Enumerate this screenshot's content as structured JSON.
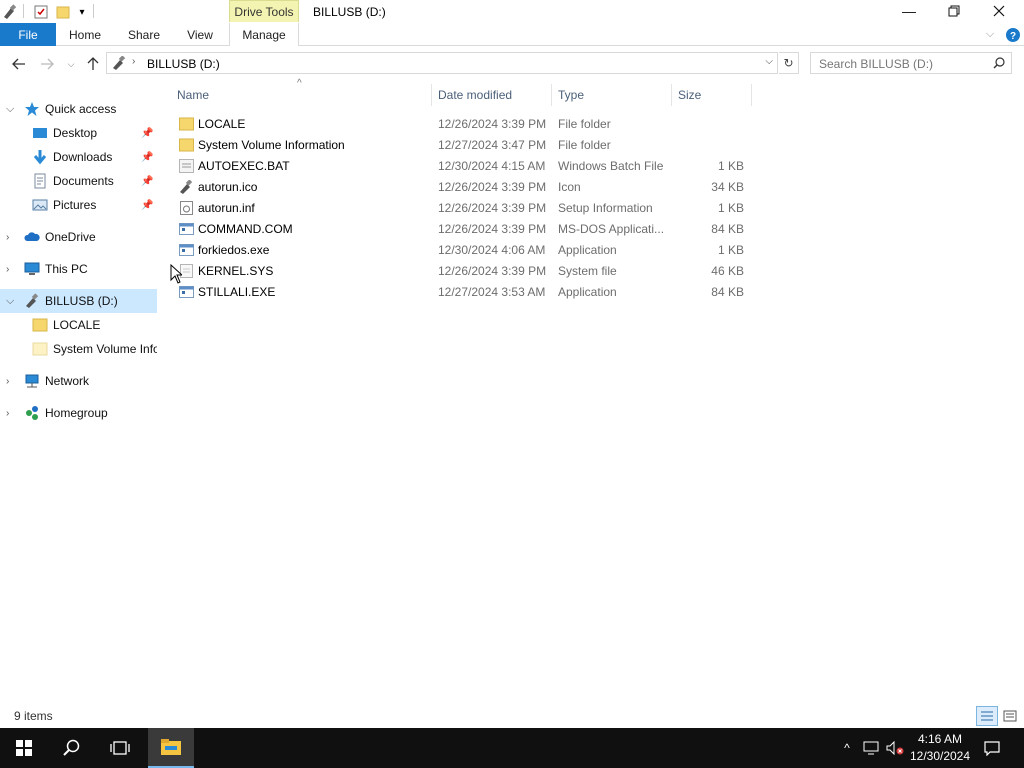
{
  "window": {
    "title": "BILLUSB (D:)",
    "drive_tools_label": "Drive Tools",
    "controls": [
      "minimize",
      "restore",
      "close"
    ]
  },
  "ribbon": {
    "tabs": [
      {
        "label": "File"
      },
      {
        "label": "Home"
      },
      {
        "label": "Share"
      },
      {
        "label": "View"
      },
      {
        "label": "Manage"
      }
    ]
  },
  "address": {
    "path": "BILLUSB (D:)",
    "search_placeholder": "Search BILLUSB (D:)"
  },
  "navpane": {
    "quick_access": "Quick access",
    "quick_items": [
      {
        "label": "Desktop"
      },
      {
        "label": "Downloads"
      },
      {
        "label": "Documents"
      },
      {
        "label": "Pictures"
      }
    ],
    "onedrive": "OneDrive",
    "thispc": "This PC",
    "drive": "BILLUSB (D:)",
    "drive_children": [
      {
        "label": "LOCALE"
      },
      {
        "label": "System Volume Information"
      }
    ],
    "network": "Network",
    "homegroup": "Homegroup"
  },
  "columns": {
    "name": "Name",
    "date": "Date modified",
    "type": "Type",
    "size": "Size"
  },
  "files": [
    {
      "name": "LOCALE",
      "date": "12/26/2024 3:39 PM",
      "type": "File folder",
      "size": "",
      "icon": "folder-icon"
    },
    {
      "name": "System Volume Information",
      "date": "12/27/2024 3:47 PM",
      "type": "File folder",
      "size": "",
      "icon": "folder-icon"
    },
    {
      "name": "AUTOEXEC.BAT",
      "date": "12/30/2024 4:15 AM",
      "type": "Windows Batch File",
      "size": "1 KB",
      "icon": "batch-file-icon"
    },
    {
      "name": "autorun.ico",
      "date": "12/26/2024 3:39 PM",
      "type": "Icon",
      "size": "34 KB",
      "icon": "usb-drive-icon"
    },
    {
      "name": "autorun.inf",
      "date": "12/26/2024 3:39 PM",
      "type": "Setup Information",
      "size": "1 KB",
      "icon": "setup-info-icon"
    },
    {
      "name": "COMMAND.COM",
      "date": "12/26/2024 3:39 PM",
      "type": "MS-DOS Applicati...",
      "size": "84 KB",
      "icon": "application-icon"
    },
    {
      "name": "forkiedos.exe",
      "date": "12/30/2024 4:06 AM",
      "type": "Application",
      "size": "1 KB",
      "icon": "application-icon"
    },
    {
      "name": "KERNEL.SYS",
      "date": "12/26/2024 3:39 PM",
      "type": "System file",
      "size": "46 KB",
      "icon": "system-file-icon"
    },
    {
      "name": "STILLALI.EXE",
      "date": "12/27/2024 3:53 AM",
      "type": "Application",
      "size": "84 KB",
      "icon": "application-icon"
    }
  ],
  "status": {
    "items": "9 items"
  },
  "taskbar": {
    "time": "4:16 AM",
    "date": "12/30/2024"
  },
  "colors": {
    "accent": "#1979ca",
    "selection": "#cce8ff",
    "taskbar": "#101010",
    "folder": "#f5d76e"
  }
}
